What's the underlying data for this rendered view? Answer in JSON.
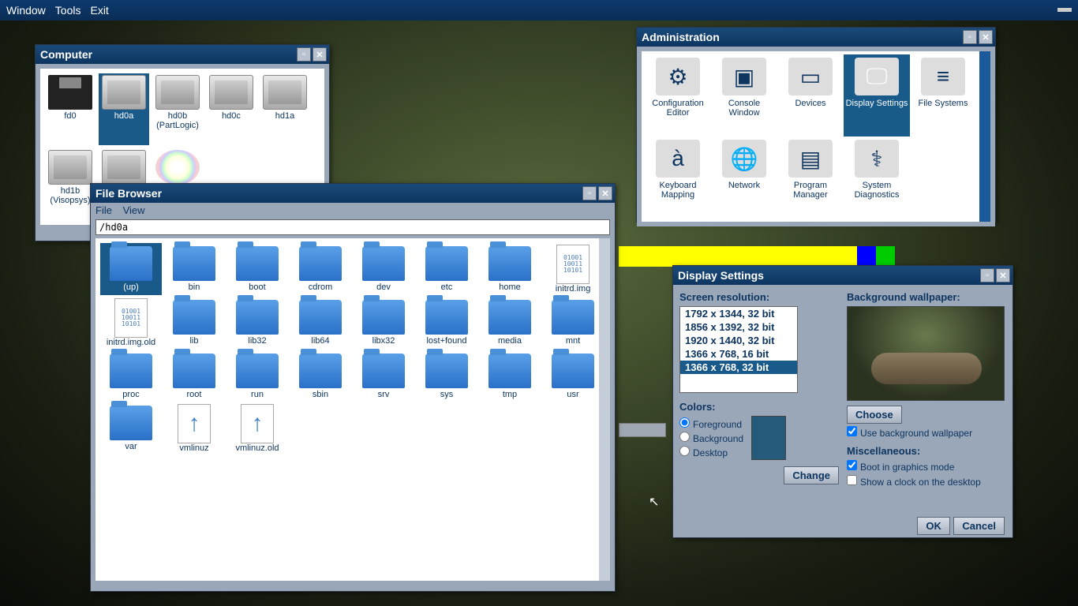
{
  "menubar": {
    "window": "Window",
    "tools": "Tools",
    "exit": "Exit"
  },
  "computer": {
    "title": "Computer",
    "drives": [
      {
        "name": "fd0",
        "type": "floppy"
      },
      {
        "name": "hd0a",
        "type": "hdd",
        "sel": true
      },
      {
        "name": "hd0b (PartLogic)",
        "type": "hdd"
      },
      {
        "name": "hd0c",
        "type": "hdd"
      },
      {
        "name": "hd1a",
        "type": "hdd"
      },
      {
        "name": "hd1b (Visopsys)",
        "type": "hdd"
      },
      {
        "name": "",
        "type": "hdd"
      },
      {
        "name": "",
        "type": "cd"
      }
    ]
  },
  "admin": {
    "title": "Administration",
    "items": [
      {
        "label": "Configuration Editor",
        "glyph": "⚙"
      },
      {
        "label": "Console Window",
        "glyph": "▣"
      },
      {
        "label": "Devices",
        "glyph": "▭"
      },
      {
        "label": "Display Settings",
        "glyph": "🖵",
        "sel": true
      },
      {
        "label": "File Systems",
        "glyph": "≡"
      },
      {
        "label": "Keyboard Mapping",
        "glyph": "à"
      },
      {
        "label": "Network",
        "glyph": "🌐"
      },
      {
        "label": "Program Manager",
        "glyph": "▤"
      },
      {
        "label": "System Diagnostics",
        "glyph": "⚕"
      }
    ]
  },
  "filebrowser": {
    "title": "File Browser",
    "menu": {
      "file": "File",
      "view": "View"
    },
    "path": "/hd0a",
    "items": [
      {
        "name": "(up)",
        "type": "folder",
        "sel": true
      },
      {
        "name": "bin",
        "type": "folder"
      },
      {
        "name": "boot",
        "type": "folder"
      },
      {
        "name": "cdrom",
        "type": "folder"
      },
      {
        "name": "dev",
        "type": "folder"
      },
      {
        "name": "etc",
        "type": "folder"
      },
      {
        "name": "home",
        "type": "folder"
      },
      {
        "name": "initrd.img",
        "type": "txt"
      },
      {
        "name": "initrd.img.old",
        "type": "txt"
      },
      {
        "name": "lib",
        "type": "folder"
      },
      {
        "name": "lib32",
        "type": "folder"
      },
      {
        "name": "lib64",
        "type": "folder"
      },
      {
        "name": "libx32",
        "type": "folder"
      },
      {
        "name": "lost+found",
        "type": "folder"
      },
      {
        "name": "media",
        "type": "folder"
      },
      {
        "name": "mnt",
        "type": "folder"
      },
      {
        "name": "proc",
        "type": "folder"
      },
      {
        "name": "root",
        "type": "folder"
      },
      {
        "name": "run",
        "type": "folder"
      },
      {
        "name": "sbin",
        "type": "folder"
      },
      {
        "name": "srv",
        "type": "folder"
      },
      {
        "name": "sys",
        "type": "folder"
      },
      {
        "name": "tmp",
        "type": "folder"
      },
      {
        "name": "usr",
        "type": "folder"
      },
      {
        "name": "var",
        "type": "folder"
      },
      {
        "name": "vmlinuz",
        "type": "arrow"
      },
      {
        "name": "vmlinuz.old",
        "type": "arrow"
      }
    ]
  },
  "display": {
    "title": "Display Settings",
    "res_label": "Screen resolution:",
    "resolutions": [
      "1792 x 1344, 32 bit",
      "1856 x 1392, 32 bit",
      "1920 x 1440, 32 bit",
      "1366 x 768, 16 bit",
      "1366 x 768, 32 bit"
    ],
    "res_selected": 4,
    "colors_label": "Colors:",
    "color_fg": "Foreground",
    "color_bg": "Background",
    "color_dt": "Desktop",
    "change": "Change",
    "wp_label": "Background wallpaper:",
    "choose": "Choose",
    "use_wp": "Use background wallpaper",
    "misc_label": "Miscellaneous:",
    "boot_gfx": "Boot in graphics mode",
    "show_clock": "Show a clock on the desktop",
    "ok": "OK",
    "cancel": "Cancel"
  }
}
